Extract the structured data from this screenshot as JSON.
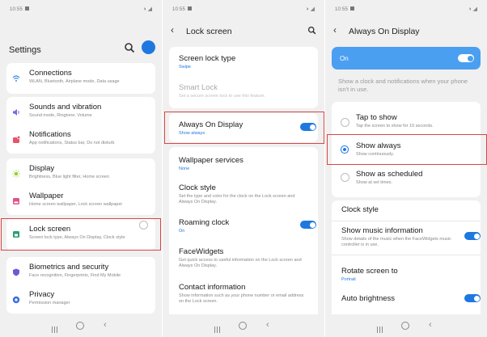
{
  "screen1": {
    "status_time": "10:55",
    "title": "Settings",
    "items": [
      {
        "title": "Connections",
        "subtitle": "WLAN, Bluetooth, Airplane mode, Data usage",
        "icon": "wifi-icon",
        "color": "#3b8fe8"
      },
      {
        "title": "Sounds and vibration",
        "subtitle": "Sound mode, Ringtone, Volume",
        "icon": "speaker-icon",
        "color": "#6b6fe0"
      },
      {
        "title": "Notifications",
        "subtitle": "App notifications, Status bar, Do not disturb",
        "icon": "bell-icon",
        "color": "#e8536b"
      },
      {
        "title": "Display",
        "subtitle": "Brightness, Blue light filter, Home screen",
        "icon": "sun-icon",
        "color": "#9acd32"
      },
      {
        "title": "Wallpaper",
        "subtitle": "Home screen wallpaper, Lock screen wallpaper",
        "icon": "wallpaper-icon",
        "color": "#e0558c"
      },
      {
        "title": "Lock screen",
        "subtitle": "Screen lock type, Always On Display, Clock style",
        "icon": "lock-screen-icon",
        "color": "#2aa070"
      },
      {
        "title": "Biometrics and security",
        "subtitle": "Face recognition, Fingerprints, Find My Mobile",
        "icon": "shield-icon",
        "color": "#6b5bd6"
      },
      {
        "title": "Privacy",
        "subtitle": "Permission manager",
        "icon": "privacy-icon",
        "color": "#3b6fe0"
      }
    ]
  },
  "screen2": {
    "status_time": "10:55",
    "title": "Lock screen",
    "items": [
      {
        "title": "Screen lock type",
        "subtitle": "Swipe"
      },
      {
        "title": "Smart Lock",
        "subtitle": "Set a secure screen lock to use this feature."
      },
      {
        "title": "Always On Display",
        "subtitle": "Show always"
      },
      {
        "title": "Wallpaper services",
        "subtitle": "None"
      },
      {
        "title": "Clock style",
        "subtitle": "Set the type and color for the clock on the Lock screen and Always On Display."
      },
      {
        "title": "Roaming clock",
        "subtitle": "On"
      },
      {
        "title": "FaceWidgets",
        "subtitle": "Get quick access to useful information on the Lock screen and Always On Display."
      },
      {
        "title": "Contact information",
        "subtitle": "Show information such as your phone number or email address on the Lock screen."
      }
    ]
  },
  "screen3": {
    "status_time": "10:55",
    "title": "Always On Display",
    "on_label": "On",
    "description": "Show a clock and notifications when your phone isn't in use.",
    "options": [
      {
        "title": "Tap to show",
        "subtitle": "Tap the screen to show for 10 seconds."
      },
      {
        "title": "Show always",
        "subtitle": "Show continuously."
      },
      {
        "title": "Show as scheduled",
        "subtitle": "Show at set times."
      }
    ],
    "items": [
      {
        "title": "Clock style",
        "subtitle": ""
      },
      {
        "title": "Show music information",
        "subtitle": "Show details of the music when the FaceWidgets music controller is in use."
      },
      {
        "title": "Rotate screen to",
        "subtitle": "Portrait"
      },
      {
        "title": "Auto brightness",
        "subtitle": ""
      }
    ]
  },
  "colors": {
    "accent": "#1e78e0",
    "highlight": "#d94545",
    "banner": "#4b9ff0"
  }
}
